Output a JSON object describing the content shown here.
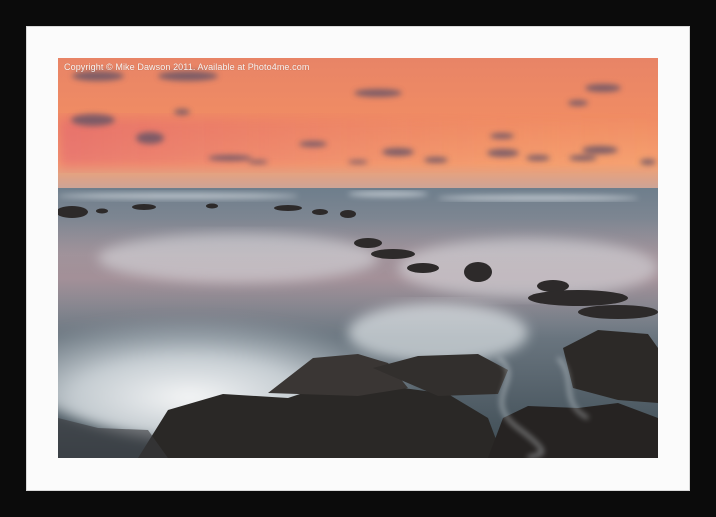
{
  "framed_print": {
    "watermark": "Copyright © Mike Dawson 2011. Available at Photo4me.com",
    "frame_color": "#0b0b0b",
    "mount_color": "#fbfbfb"
  }
}
